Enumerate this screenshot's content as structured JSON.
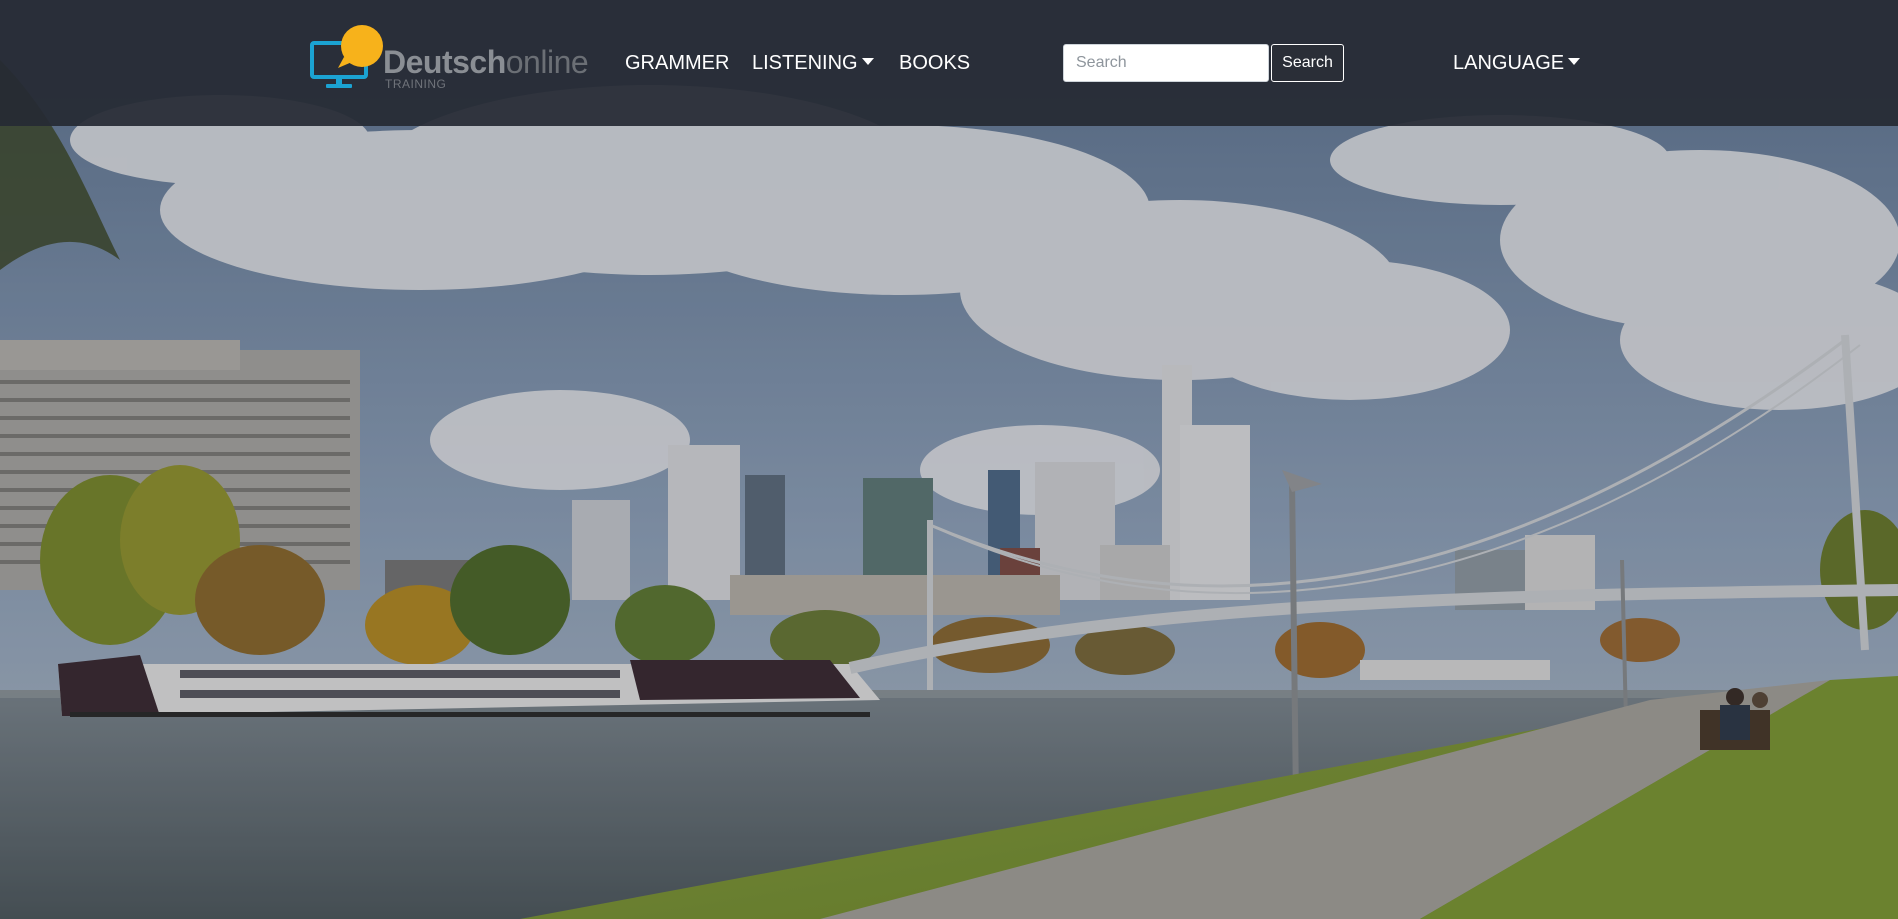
{
  "colors": {
    "navbar_bg": "#262a34",
    "nav_text": "#ffffff",
    "logo_blue": "#1ba3d3",
    "logo_yellow": "#f7b21b",
    "brand_gray": "#8a8e94"
  },
  "brand": {
    "word1": "Deutsch",
    "word2": "online",
    "tagline": "TRAINING",
    "logo_icon": "monitor-with-speech-bubble-icon"
  },
  "nav": {
    "grammer": "GRAMMER",
    "listening": "LISTENING",
    "books": "BOOKS",
    "language": "LANGUAGE"
  },
  "search": {
    "placeholder": "Search",
    "value": "",
    "button_label": "Search"
  },
  "hero": {
    "description_icon": "frankfurt-skyline-river-photo"
  }
}
